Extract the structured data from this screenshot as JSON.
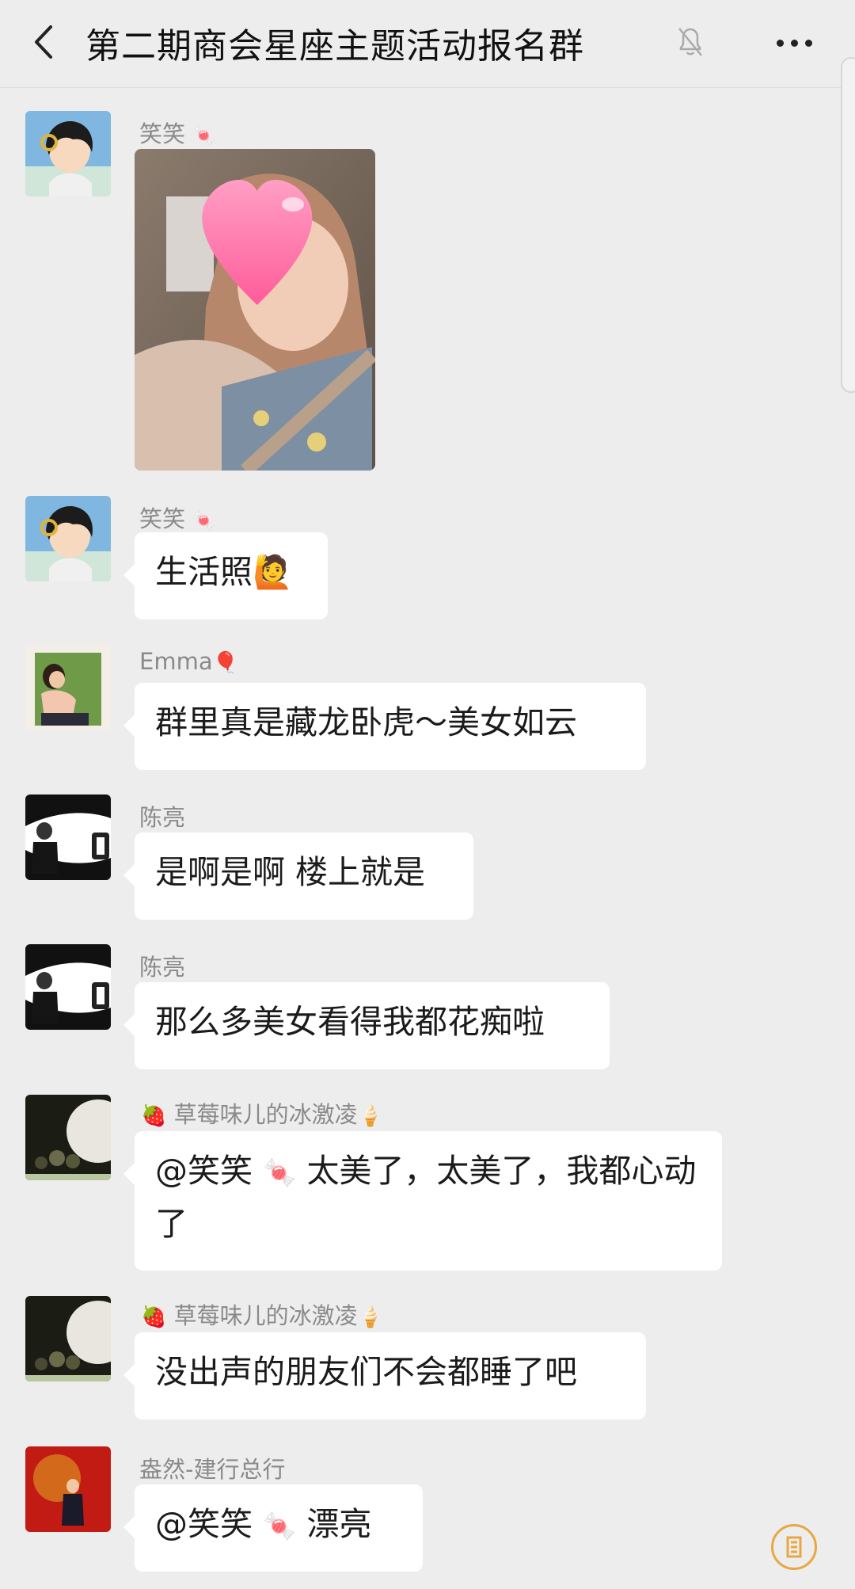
{
  "header": {
    "title": "第二期商会星座主题活动报名群"
  },
  "messages": [
    {
      "sender": "笑笑",
      "type": "image"
    },
    {
      "sender": "笑笑",
      "text": "生活照"
    },
    {
      "sender": "Emma",
      "text": "群里真是藏龙卧虎～美女如云"
    },
    {
      "sender": "陈亮",
      "text": "是啊是啊 楼上就是"
    },
    {
      "sender": "陈亮",
      "text": "那么多美女看得我都花痴啦"
    },
    {
      "sender": "草莓味儿的冰激凌",
      "mention": "@笑笑",
      "text": "太美了，太美了，我都心动了"
    },
    {
      "sender": "草莓味儿的冰激凌",
      "text": "没出声的朋友们不会都睡了吧"
    },
    {
      "sender": "盎然-建行总行",
      "mention": "@笑笑",
      "text": "漂亮"
    }
  ],
  "colors": {
    "background": "#ededed",
    "bubble": "#ffffff",
    "sender_name": "#8a8a8a"
  }
}
